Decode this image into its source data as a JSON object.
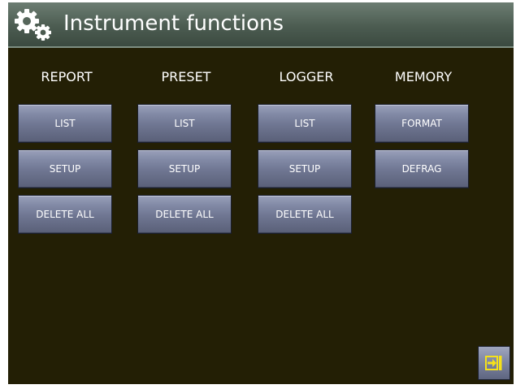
{
  "header": {
    "title": "Instrument functions",
    "icon": "gears-icon"
  },
  "columns": [
    {
      "header": "REPORT",
      "buttons": [
        "LIST",
        "SETUP",
        "DELETE ALL"
      ]
    },
    {
      "header": "PRESET",
      "buttons": [
        "LIST",
        "SETUP",
        "DELETE ALL"
      ]
    },
    {
      "header": "LOGGER",
      "buttons": [
        "LIST",
        "SETUP",
        "DELETE ALL"
      ]
    },
    {
      "header": "MEMORY",
      "buttons": [
        "FORMAT",
        "DEFRAG"
      ]
    }
  ],
  "footer": {
    "exit_icon": "exit-arrow-icon",
    "exit_icon_color": "#f5e11a"
  },
  "colors": {
    "background": "#231f05",
    "title_bar": "#4c5c51",
    "button": "#7c83a0"
  }
}
